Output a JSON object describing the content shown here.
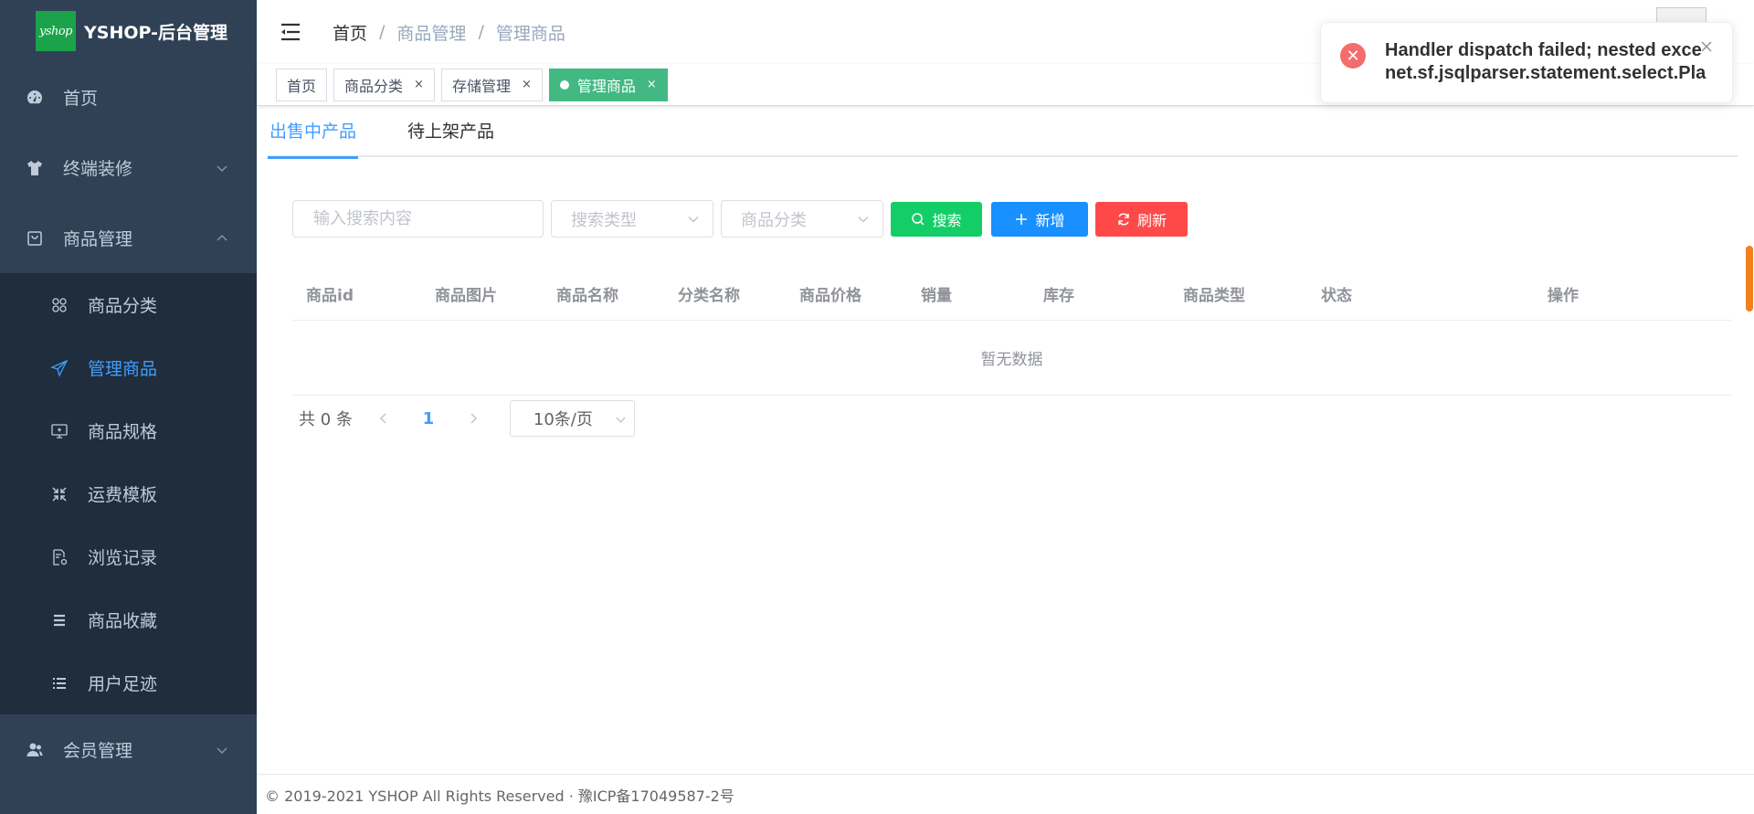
{
  "app": {
    "logo_text": "yshop",
    "title": "YSHOP-后台管理"
  },
  "sidebar": {
    "items": [
      {
        "label": "首页",
        "icon": "dashboard-icon"
      },
      {
        "label": "终端装修",
        "icon": "shirt-icon",
        "expandable": true,
        "expanded": false
      },
      {
        "label": "商品管理",
        "icon": "shopping-bag-icon",
        "expandable": true,
        "expanded": true
      },
      {
        "label": "会员管理",
        "icon": "users-icon",
        "expandable": true,
        "expanded": false
      }
    ],
    "submenu": [
      {
        "label": "商品分类",
        "icon": "category-grid-icon"
      },
      {
        "label": "管理商品",
        "icon": "paper-plane-icon",
        "active": true
      },
      {
        "label": "商品规格",
        "icon": "monitor-icon"
      },
      {
        "label": "运费模板",
        "icon": "shrink-icon"
      },
      {
        "label": "浏览记录",
        "icon": "document-gear-icon"
      },
      {
        "label": "商品收藏",
        "icon": "menu-lines-icon"
      },
      {
        "label": "用户足迹",
        "icon": "list-icon"
      }
    ]
  },
  "breadcrumb": [
    "首页",
    "商品管理",
    "管理商品"
  ],
  "breadcrumb_sep": "/",
  "tags": [
    {
      "label": "首页",
      "closable": false
    },
    {
      "label": "商品分类",
      "closable": true
    },
    {
      "label": "存储管理",
      "closable": true
    },
    {
      "label": "管理商品",
      "closable": true,
      "active": true
    }
  ],
  "tag_close": "×",
  "tabs": [
    {
      "label": "出售中产品",
      "active": true
    },
    {
      "label": "待上架产品",
      "active": false
    }
  ],
  "filters": {
    "search_placeholder": "输入搜索内容",
    "type_placeholder": "搜索类型",
    "category_placeholder": "商品分类",
    "search_button": "搜索",
    "add_button": "新增",
    "refresh_button": "刷新"
  },
  "table": {
    "columns": [
      "商品id",
      "商品图片",
      "商品名称",
      "分类名称",
      "商品价格",
      "销量",
      "库存",
      "商品类型",
      "状态",
      "操作"
    ],
    "empty_text": "暂无数据"
  },
  "pagination": {
    "total_text": "共 0 条",
    "current_page": "1",
    "page_size": "10条/页"
  },
  "footer": {
    "text": "© 2019-2021 YSHOP All Rights Reserved · 豫ICP备17049587-2号"
  },
  "notification": {
    "type": "error",
    "line1": "Handler dispatch failed; nested exce",
    "line2": "net.sf.jsqlparser.statement.select.Pla"
  },
  "colors": {
    "sidebar_bg": "#304156",
    "submenu_bg": "#1f2d3d",
    "active_blue": "#409eff",
    "tag_active": "#42b983",
    "search_green": "#13ce66",
    "add_blue": "#1890ff",
    "refresh_red": "#ff4949",
    "error_red": "#f56c6c"
  }
}
